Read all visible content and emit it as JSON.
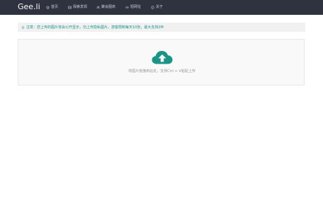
{
  "navbar": {
    "brand": "Gee.li",
    "items": [
      {
        "label": "首页",
        "icon": "home-icon"
      },
      {
        "label": "探索发现",
        "icon": "image-icon"
      },
      {
        "label": "聚会图床",
        "icon": "users-icon"
      },
      {
        "label": "短网址",
        "icon": "link-icon"
      },
      {
        "label": "关于",
        "icon": "info-icon"
      }
    ]
  },
  "notice": {
    "icon": "bell-icon",
    "text": "注意：您上传的图片将会公开显示，勿上传隐私图片。游客限制每天10张，最大支持2M"
  },
  "upload": {
    "icon": "cloud-upload-icon",
    "hint": "将图片拖拽到此处，支持Ctrl + V粘贴上传"
  },
  "colors": {
    "navbar_bg": "#2f3340",
    "accent": "#1a9487",
    "notice_bg": "#f1f1f1",
    "dropzone_bg": "#f9f9f9"
  }
}
